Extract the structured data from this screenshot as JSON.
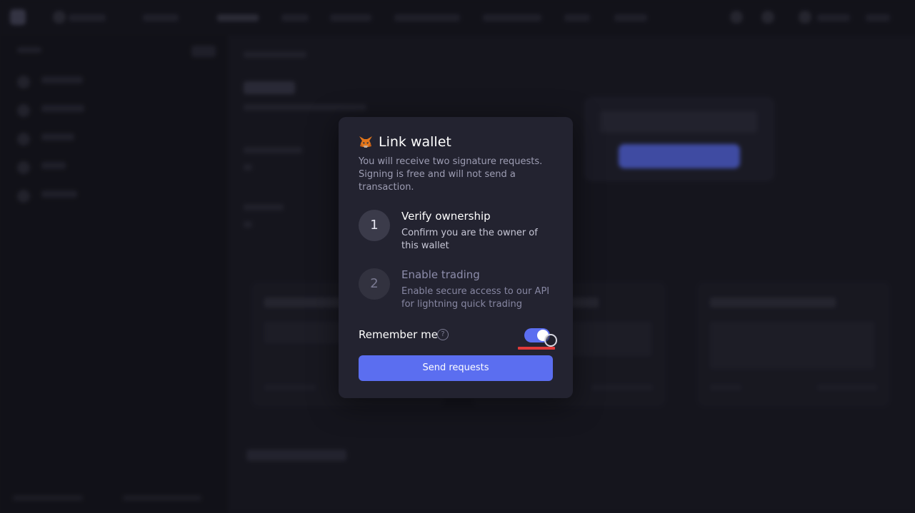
{
  "modal": {
    "title": "Link wallet",
    "description": "You will receive two signature requests. Signing is free and will not send a transaction.",
    "steps": [
      {
        "number": "1",
        "title": "Verify ownership",
        "description": "Confirm you are the owner of this wallet"
      },
      {
        "number": "2",
        "title": "Enable trading",
        "description": "Enable secure access to our API for lightning quick trading"
      }
    ],
    "remember_label": "Remember me",
    "help_glyph": "?",
    "remember_enabled": true,
    "send_label": "Send requests",
    "icon": "metamask-fox-icon"
  },
  "colors": {
    "accent": "#5b6ef0",
    "modal_bg": "#232330",
    "page_bg": "#17171f",
    "focus_marker": "#e13a3a"
  }
}
